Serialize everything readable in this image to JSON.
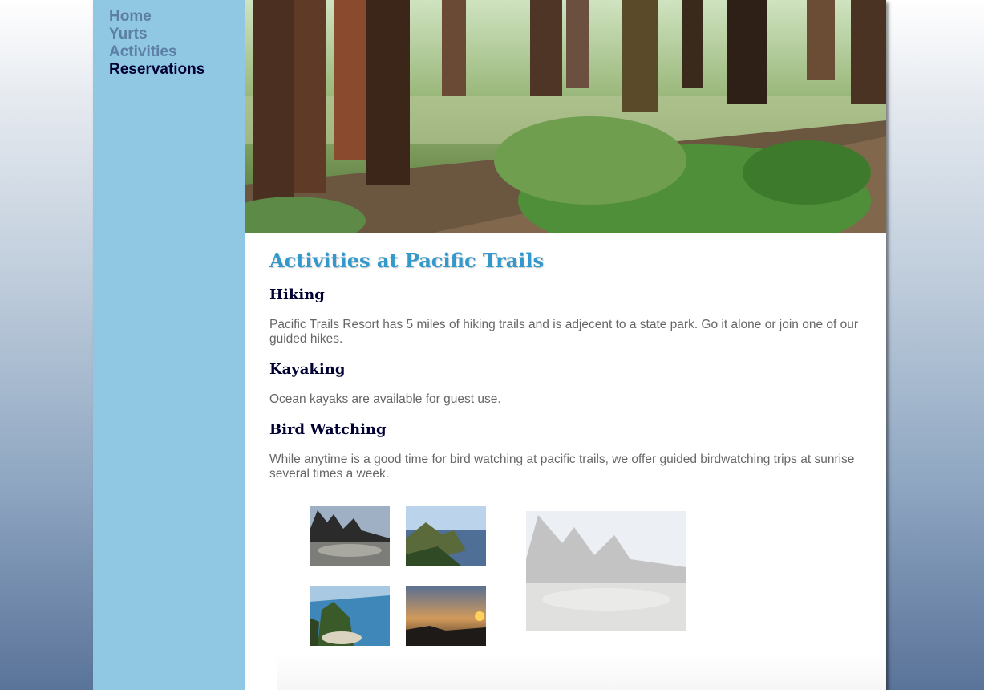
{
  "nav": {
    "items": [
      {
        "label": "Home"
      },
      {
        "label": "Yurts"
      },
      {
        "label": "Activities"
      },
      {
        "label": "Reservations"
      }
    ]
  },
  "main": {
    "title": "Activities at Pacific Trails",
    "sections": [
      {
        "heading": "Hiking",
        "text": "Pacific Trails Resort has 5 miles of hiking trails and is adjecent to a state park. Go it alone or join one of our guided hikes."
      },
      {
        "heading": "Kayaking",
        "text": "Ocean kayaks are available for guest use."
      },
      {
        "heading": "Bird Watching",
        "text": "While anytime is a good time for bird watching at pacific trails, we offer guided birdwatching trips at sunrise several times a week."
      }
    ]
  },
  "colors": {
    "nav_background": "#90c7e3",
    "title": "#3399cc",
    "heading": "#000033",
    "body_text": "#666666",
    "nav_link": "#5c7fa3"
  }
}
